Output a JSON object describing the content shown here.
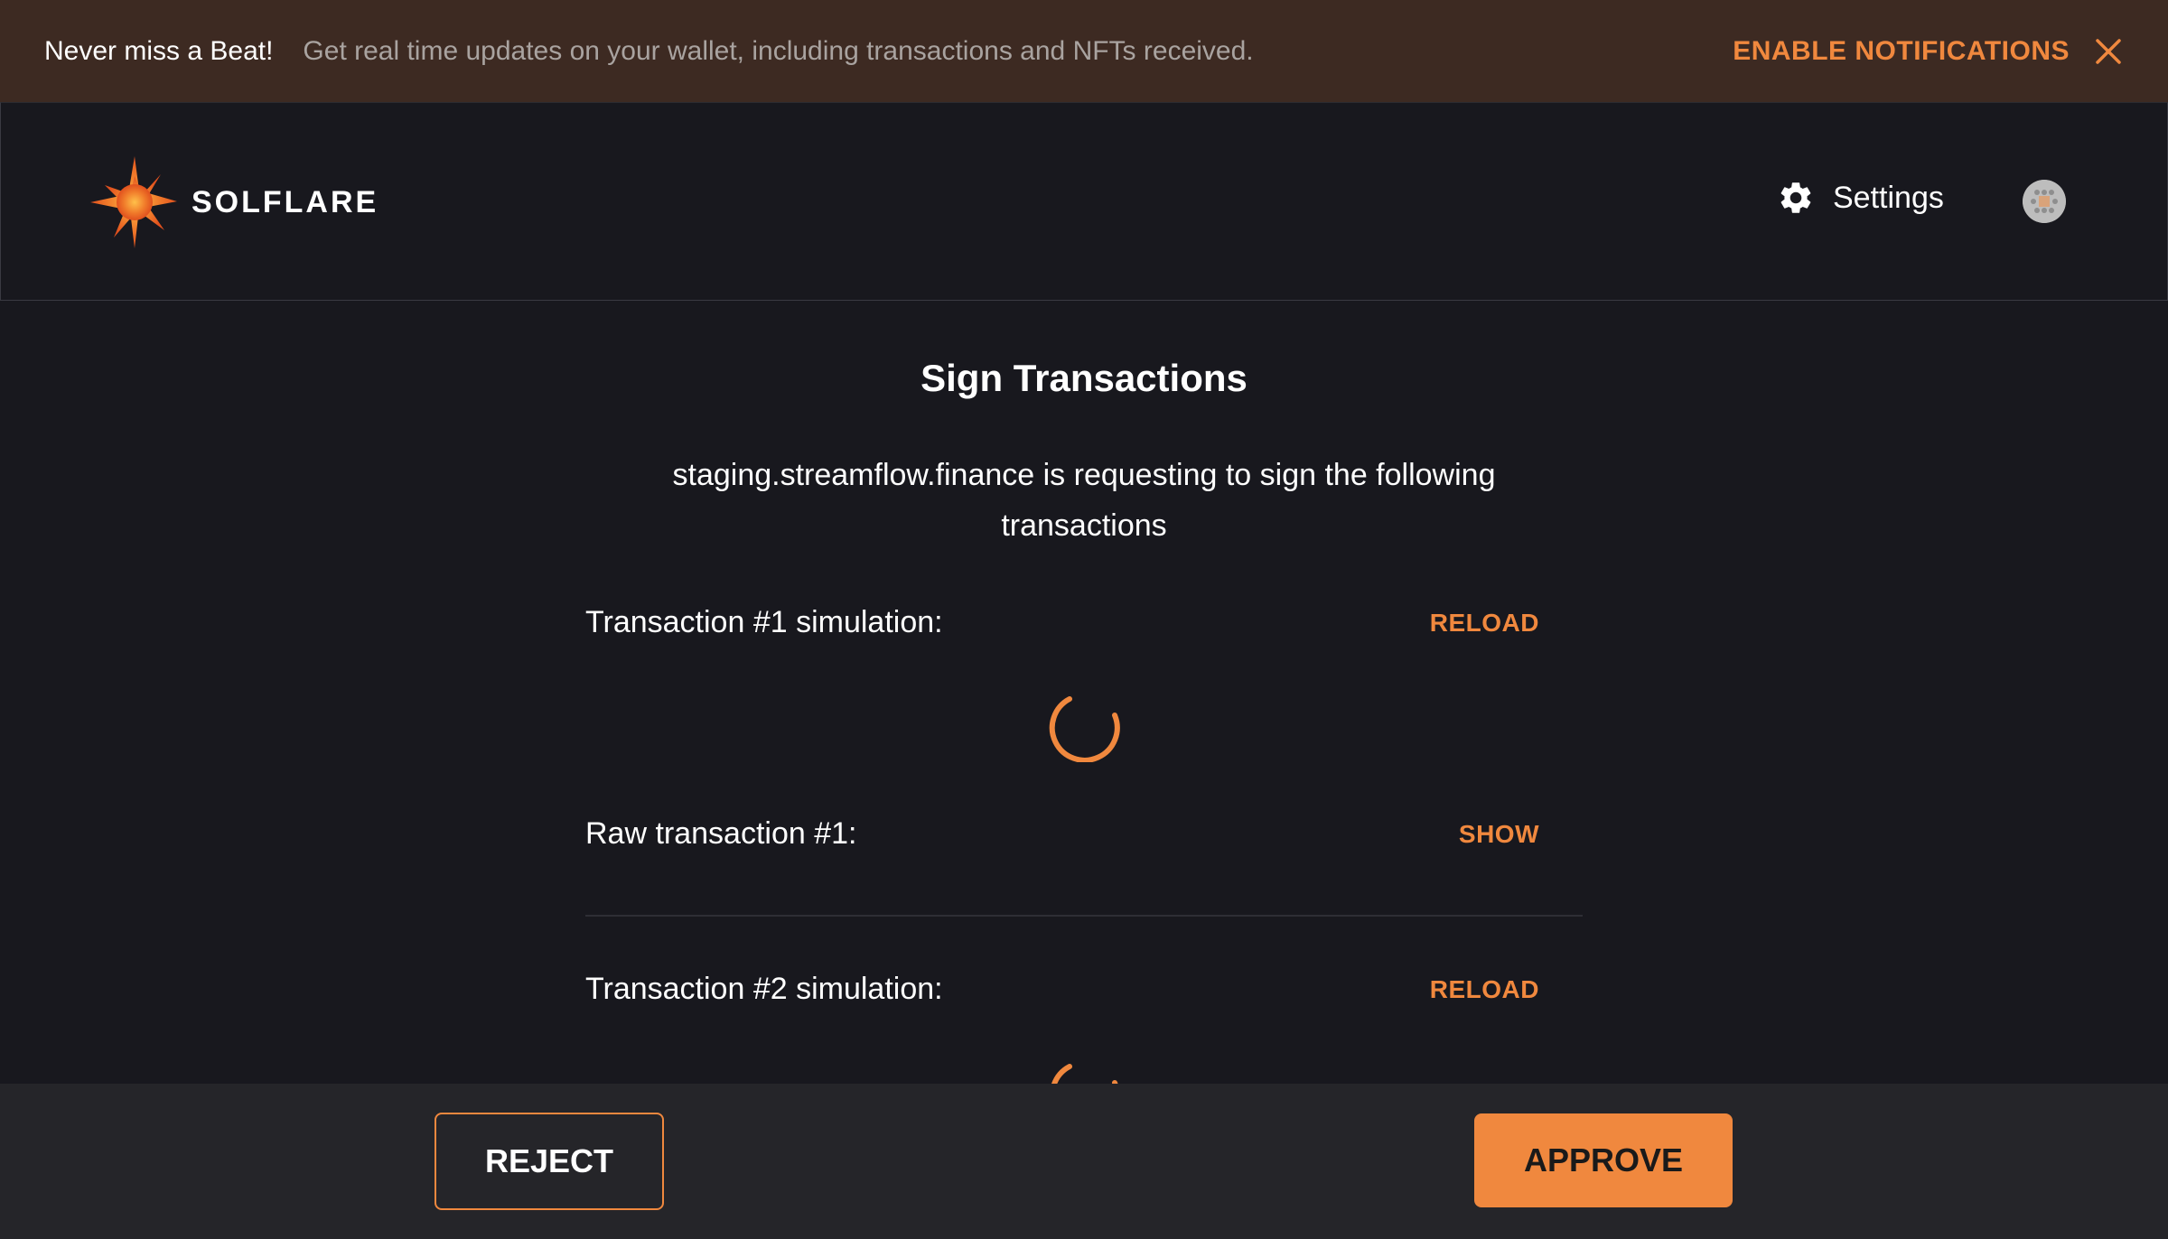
{
  "banner": {
    "title": "Never miss a Beat!",
    "text": "Get real time updates on your wallet, including transactions and NFTs received.",
    "enable_label": "ENABLE NOTIFICATIONS",
    "close_icon": "close-icon"
  },
  "header": {
    "logo_text": "SOLFLARE",
    "logo_icon": "solflare-star-icon",
    "settings_label": "Settings",
    "settings_icon": "gear-icon",
    "avatar_icon": "avatar"
  },
  "main": {
    "title": "Sign Transactions",
    "subtitle_line1": "staging.streamflow.finance is requesting to sign the following",
    "subtitle_line2": "transactions",
    "transactions": [
      {
        "simulation_label": "Transaction #1 simulation:",
        "reload_label": "RELOAD",
        "raw_label": "Raw transaction #1:",
        "show_label": "SHOW"
      },
      {
        "simulation_label": "Transaction #2 simulation:",
        "reload_label": "RELOAD"
      }
    ]
  },
  "footer": {
    "reject_label": "REJECT",
    "approve_label": "APPROVE"
  },
  "colors": {
    "accent": "#f0883e",
    "background": "#18181e",
    "banner_bg": "#3d2a22",
    "footer_bg": "#252529"
  }
}
